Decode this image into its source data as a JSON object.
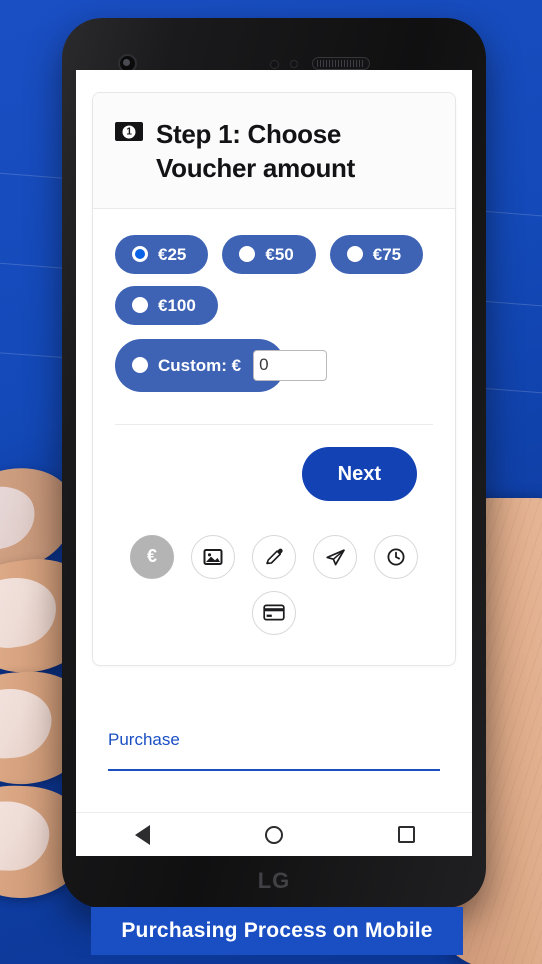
{
  "caption": {
    "text": "Purchasing Process on Mobile"
  },
  "phone": {
    "brand": "LG"
  },
  "card": {
    "title": "Step 1: Choose Voucher amount",
    "title_icon": "banknote-icon",
    "amounts": [
      {
        "label": "€25",
        "selected": true
      },
      {
        "label": "€50",
        "selected": false
      },
      {
        "label": "€75",
        "selected": false
      },
      {
        "label": "€100",
        "selected": false
      }
    ],
    "custom": {
      "label": "Custom: €",
      "selected": false,
      "value": "0",
      "placeholder": "0"
    },
    "next_label": "Next"
  },
  "steps": [
    {
      "icon": "euro-icon",
      "glyph": "€",
      "active": true
    },
    {
      "icon": "image-icon",
      "glyph": "",
      "active": false
    },
    {
      "icon": "pencil-icon",
      "glyph": "",
      "active": false
    },
    {
      "icon": "send-icon",
      "glyph": "",
      "active": false
    },
    {
      "icon": "clock-icon",
      "glyph": "",
      "active": false
    },
    {
      "icon": "credit-card-icon",
      "glyph": "",
      "active": false
    }
  ],
  "footer": {
    "purchase_label": "Purchase"
  },
  "navbar": {
    "back": "back-button",
    "home": "home-button",
    "recents": "recents-button"
  },
  "colors": {
    "background_blue": "#1a4fc4",
    "pill_blue": "#3e63b5",
    "action_blue": "#1242b4",
    "radio_accent": "#0a63e6",
    "link_blue": "#1a4fc4",
    "step_active_gray": "#b4b4b4"
  }
}
